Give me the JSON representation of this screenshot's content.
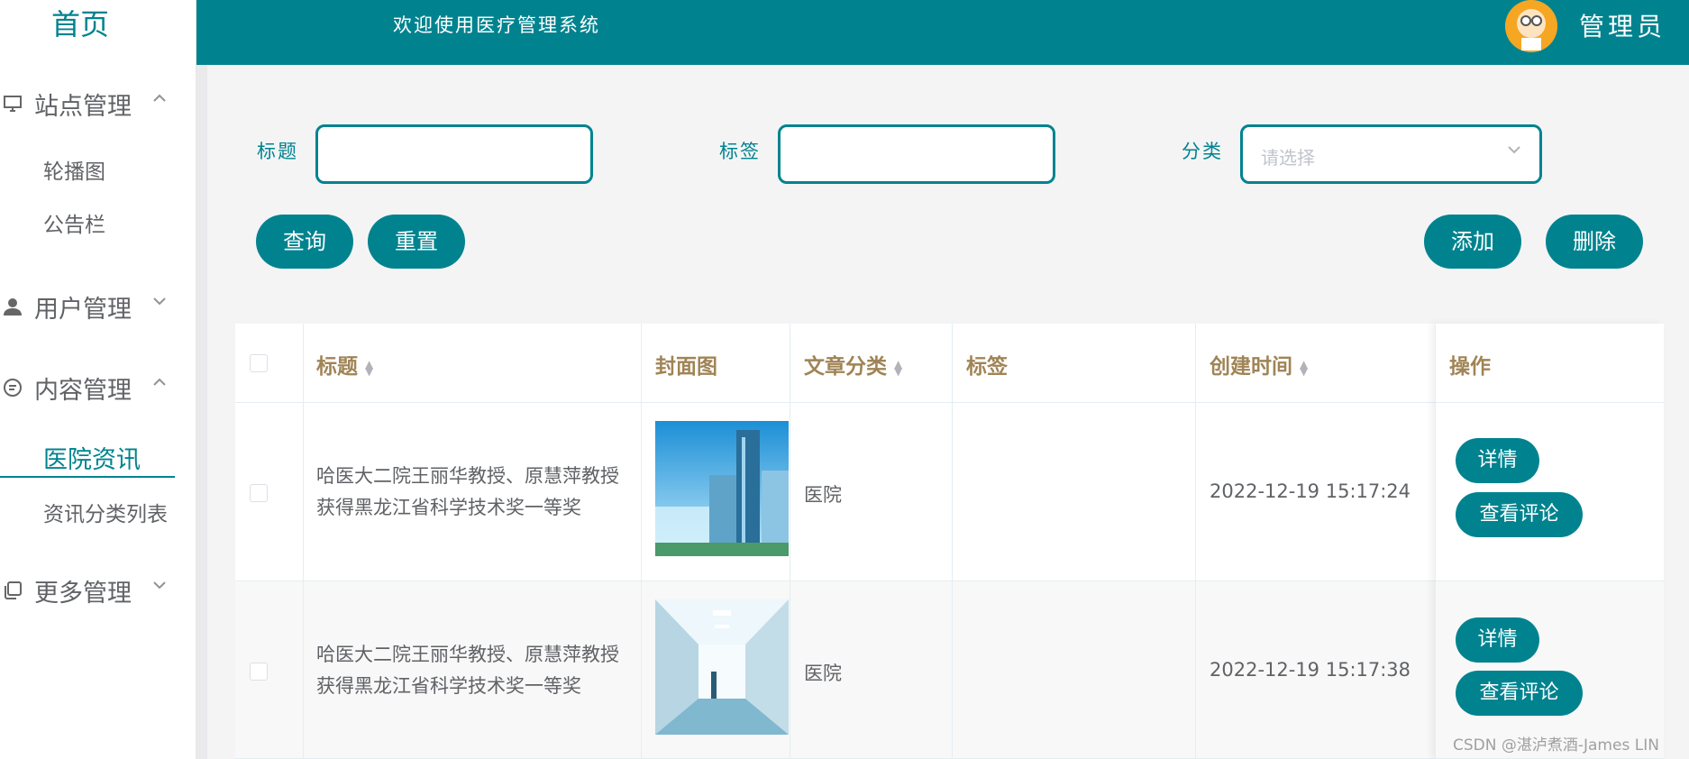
{
  "sidebar": {
    "home": "首页",
    "groups": [
      {
        "label": "站点管理",
        "chevron": "^",
        "icon": "monitor-icon"
      },
      {
        "label": "用户管理",
        "chevron": "v",
        "icon": "user-icon"
      },
      {
        "label": "内容管理",
        "chevron": "^",
        "icon": "chat-icon"
      },
      {
        "label": "更多管理",
        "chevron": "v",
        "icon": "copy-icon"
      }
    ],
    "site_items": [
      "轮播图",
      "公告栏"
    ],
    "content_items": [
      "医院资讯",
      "资讯分类列表"
    ]
  },
  "header": {
    "welcome": "欢迎使用医疗管理系统",
    "admin": "管理员"
  },
  "filters": {
    "title_label": "标题",
    "tag_label": "标签",
    "category_label": "分类",
    "category_placeholder": "请选择"
  },
  "buttons": {
    "query": "查询",
    "reset": "重置",
    "add": "添加",
    "delete": "删除"
  },
  "table": {
    "headers": [
      "标题",
      "封面图",
      "文章分类",
      "标签",
      "创建时间",
      "操作"
    ],
    "rows": [
      {
        "title_line1": "哈医大二院王丽华教授、原慧萍教授",
        "title_line2": "获得黑龙江省科学技术奖一等奖",
        "category": "医院",
        "tag": "",
        "created": "2022-12-19 15:17:24",
        "detail": "详情",
        "comments": "查看评论"
      },
      {
        "title_line1": "哈医大二院王丽华教授、原慧萍教授",
        "title_line2": "获得黑龙江省科学技术奖一等奖",
        "category": "医院",
        "tag": "",
        "created": "2022-12-19 15:17:38",
        "detail": "详情",
        "comments": "查看评论"
      }
    ]
  },
  "watermark": "CSDN @湛泸煮酒-James LIN",
  "colors": {
    "primary": "#00838f",
    "header_text": "#a08456",
    "bg": "#f4f4f5"
  }
}
